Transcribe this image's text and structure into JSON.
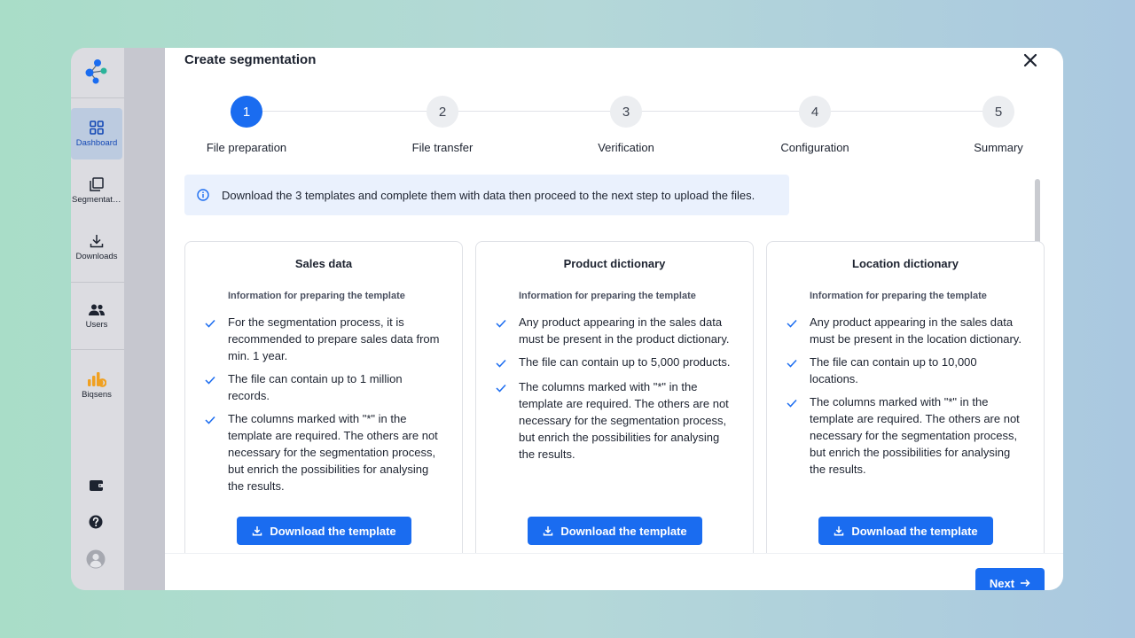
{
  "sidebar": {
    "items": [
      {
        "label": "Dashboard",
        "icon": "grid-icon",
        "active": true
      },
      {
        "label": "Segmentations",
        "icon": "layers-icon"
      },
      {
        "label": "Downloads",
        "icon": "download-icon"
      },
      {
        "label": "Users",
        "icon": "users-icon"
      },
      {
        "label": "Biqsens",
        "icon": "biqsens-logo-icon"
      }
    ],
    "bottom_icons": [
      "wallet-icon",
      "help-icon",
      "avatar-icon"
    ]
  },
  "modal": {
    "title": "Create segmentation",
    "close_icon": "close-icon"
  },
  "stepper": {
    "steps": [
      {
        "number": "1",
        "label": "File preparation",
        "active": true
      },
      {
        "number": "2",
        "label": "File transfer"
      },
      {
        "number": "3",
        "label": "Verification"
      },
      {
        "number": "4",
        "label": "Configuration"
      },
      {
        "number": "5",
        "label": "Summary"
      }
    ]
  },
  "info": {
    "text": "Download the 3 templates and complete them with data then proceed to the next step to upload the files."
  },
  "cards": [
    {
      "title": "Sales data",
      "subtitle": "Information for preparing the template",
      "bullets": [
        "For the segmentation process, it is recommended to prepare sales data from min. 1 year.",
        "The file can contain up to 1 million records.",
        "The columns marked with \"*\" in the template are required. The others are not necessary for the segmentation process, but enrich the possibilities for analysing the results."
      ],
      "button": "Download the template"
    },
    {
      "title": "Product dictionary",
      "subtitle": "Information for preparing the template",
      "bullets": [
        "Any product appearing in the sales data must be present in the product dictionary.",
        "The file can contain up to 5,000 products.",
        "The columns marked with \"*\" in the template are required. The others are not necessary for the segmentation process, but enrich the possibilities for analysing the results."
      ],
      "button": "Download the template"
    },
    {
      "title": "Location dictionary",
      "subtitle": "Information for preparing the template",
      "bullets": [
        "Any product appearing in the sales data must be present in the location dictionary.",
        "The file can contain up to 10,000 locations.",
        "The columns marked with \"*\" in the template are required. The others are not necessary for the segmentation process, but enrich the possibilities for analysing the results."
      ],
      "button": "Download the template"
    }
  ],
  "footer": {
    "next_label": "Next"
  },
  "colors": {
    "primary": "#1a6cf0",
    "info_bg": "#eaf1fd",
    "biqsens": "#f0a020"
  }
}
